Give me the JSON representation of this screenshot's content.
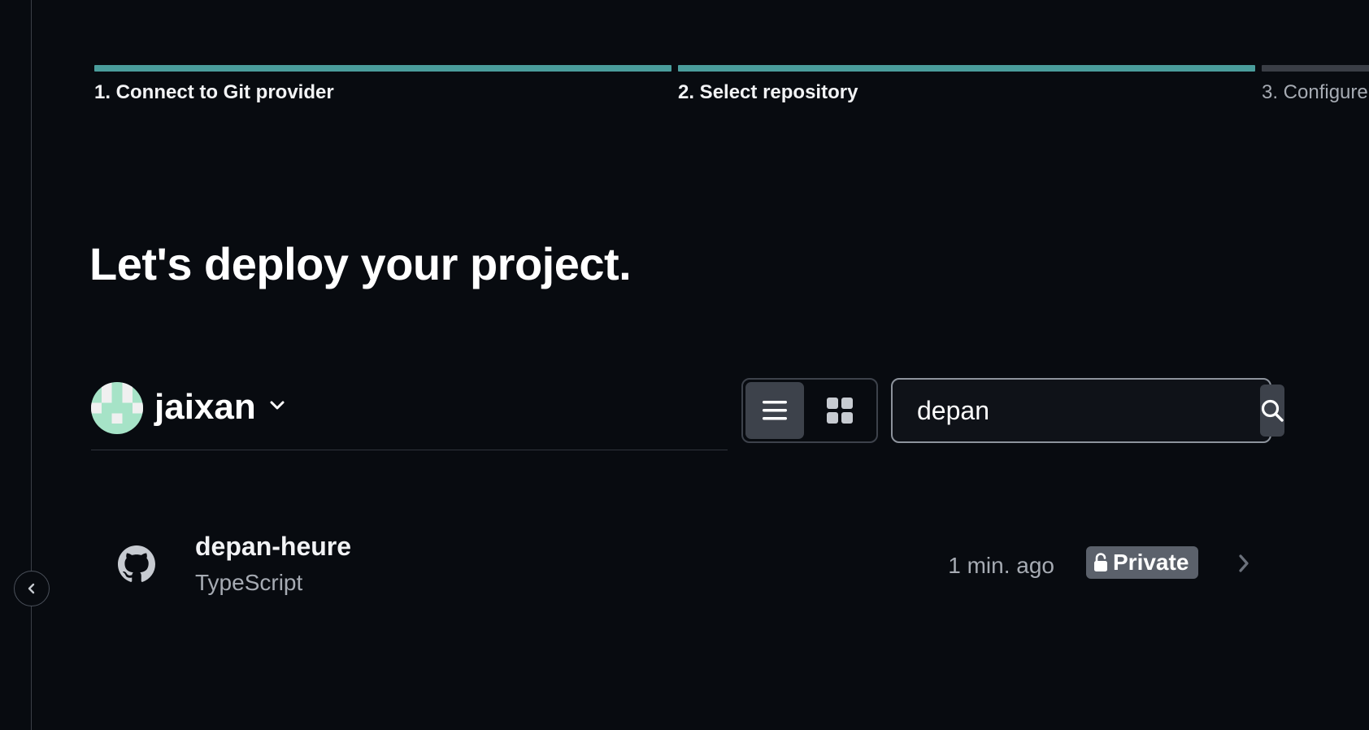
{
  "steps": [
    {
      "label": "1. Connect to Git provider",
      "state": "done"
    },
    {
      "label": "2. Select repository",
      "state": "done"
    },
    {
      "label": "3. Configure",
      "state": "todo"
    }
  ],
  "title": "Let's deploy your project.",
  "account": {
    "name": "jaixan",
    "avatar_icon": "identicon-avatar",
    "chevron_icon": "chevron-down-icon"
  },
  "view_toggle": {
    "options": [
      {
        "icon": "list-view-icon",
        "active": true
      },
      {
        "icon": "grid-view-icon",
        "active": false
      }
    ]
  },
  "search": {
    "value": "depan",
    "icon": "search-icon"
  },
  "repositories": [
    {
      "name": "depan-heure",
      "language": "TypeScript",
      "updated": "1 min. ago",
      "visibility": "Private",
      "provider_icon": "github-icon",
      "visibility_icon": "unlock-icon"
    }
  ],
  "colors": {
    "background": "#080b10",
    "step_done": "#4a9d9c",
    "step_todo": "#3a3e46",
    "badge": "#5b616b",
    "avatar_fg": "#a6e3c7"
  }
}
